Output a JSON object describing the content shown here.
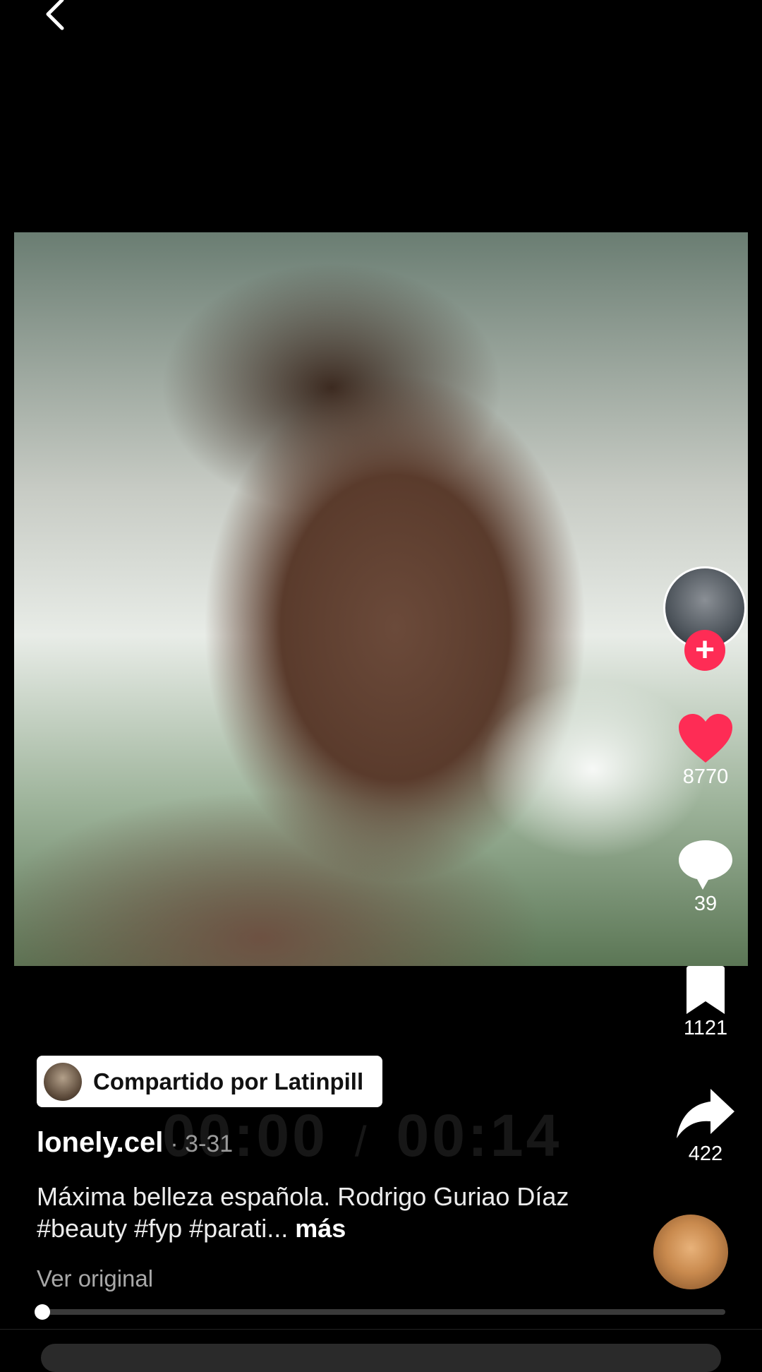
{
  "video": {
    "elapsed": "00:00",
    "separator": "/",
    "duration": "00:14",
    "progress_fraction": 0.0
  },
  "actions": {
    "likes": "8770",
    "comments": "39",
    "saves": "1121",
    "shares": "422"
  },
  "shared": {
    "label": "Compartido por Latinpill"
  },
  "post": {
    "author": "lonely.cel",
    "date": "· 3-31",
    "caption": "Máxima belleza española. Rodrigo Guriao Díaz #beauty #fyp #parati...",
    "more": "más",
    "see_original": "Ver original"
  },
  "colors": {
    "accent_red": "#fe2c55",
    "background": "#000000"
  },
  "icons": [
    "back-icon",
    "plus-icon",
    "heart-icon",
    "comment-icon",
    "bookmark-icon",
    "share-icon"
  ]
}
